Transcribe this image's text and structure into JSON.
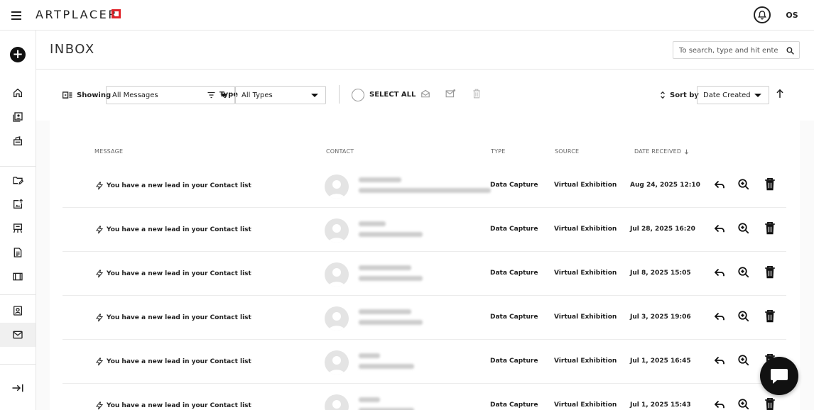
{
  "brand": {
    "logo_text": "ARTPLACER",
    "accent": "#e0252b"
  },
  "topbar": {
    "user_initials": "OS"
  },
  "page": {
    "title": "INBOX"
  },
  "search": {
    "placeholder": "To search, type and hit enter"
  },
  "toolbar": {
    "showing_label": "Showing",
    "showing_value": "All Messages",
    "type_label": "Type",
    "type_value": "All Types",
    "select_all_label": "SELECT ALL",
    "sort_label": "Sort by",
    "sort_value": "Date Created"
  },
  "table": {
    "columns": [
      "MESSAGE",
      "CONTACT",
      "TYPE",
      "SOURCE",
      "DATE RECEIVED"
    ],
    "rows": [
      {
        "message": "You have a new lead in your Contact list",
        "type": "Data Capture",
        "source": "Virtual Exhibition",
        "date": "Aug 24, 2025 12:10"
      },
      {
        "message": "You have a new lead in your Contact list",
        "type": "Data Capture",
        "source": "Virtual Exhibition",
        "date": "Jul 28, 2025 16:20"
      },
      {
        "message": "You have a new lead in your Contact list",
        "type": "Data Capture",
        "source": "Virtual Exhibition",
        "date": "Jul 8, 2025 15:05"
      },
      {
        "message": "You have a new lead in your Contact list",
        "type": "Data Capture",
        "source": "Virtual Exhibition",
        "date": "Jul 3, 2025 19:06"
      },
      {
        "message": "You have a new lead in your Contact list",
        "type": "Data Capture",
        "source": "Virtual Exhibition",
        "date": "Jul 1, 2025 16:45"
      },
      {
        "message": "You have a new lead in your Contact list",
        "type": "Data Capture",
        "source": "Virtual Exhibition",
        "date": "Jul 1, 2025 15:43"
      }
    ]
  },
  "icons": {
    "message_row": "lightning-icon",
    "actions": [
      "reply-icon",
      "zoom-icon",
      "trash-icon"
    ]
  }
}
